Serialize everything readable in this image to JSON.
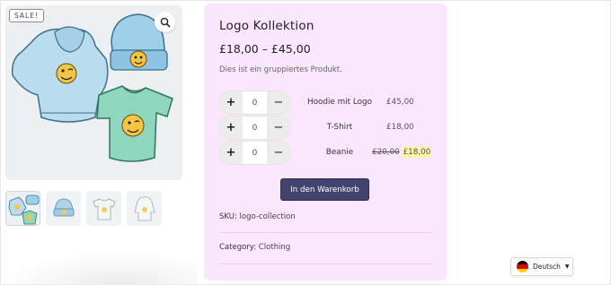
{
  "gallery": {
    "sale_badge": "SALE!",
    "zoom_icon": "magnifier-icon",
    "thumbnails": [
      "Logo Kollektion",
      "Beanie",
      "T-Shirt",
      "Hoodie mit Logo"
    ]
  },
  "product": {
    "title": "Logo Kollektion",
    "price_range": "£18,00 – £45,00",
    "description": "Dies ist ein gruppiertes Produkt.",
    "items": [
      {
        "name": "Hoodie mit Logo",
        "qty": "0",
        "price": "£45,00",
        "old_price": "",
        "sale_price": ""
      },
      {
        "name": "T-Shirt",
        "qty": "0",
        "price": "£18,00",
        "old_price": "",
        "sale_price": ""
      },
      {
        "name": "Beanie",
        "qty": "0",
        "price": "",
        "old_price": "£20,00",
        "sale_price": "£18,00"
      }
    ],
    "plus_label": "+",
    "minus_label": "−",
    "add_to_cart": "In den Warenkorb",
    "sku_label": "SKU:",
    "sku_value": "logo-collection",
    "category_label": "Category:",
    "category_value": "Clothing"
  },
  "language": {
    "label": "Deutsch",
    "caret": "▼",
    "flag_colors": [
      "#000000",
      "#dd0000",
      "#ffce00"
    ]
  }
}
